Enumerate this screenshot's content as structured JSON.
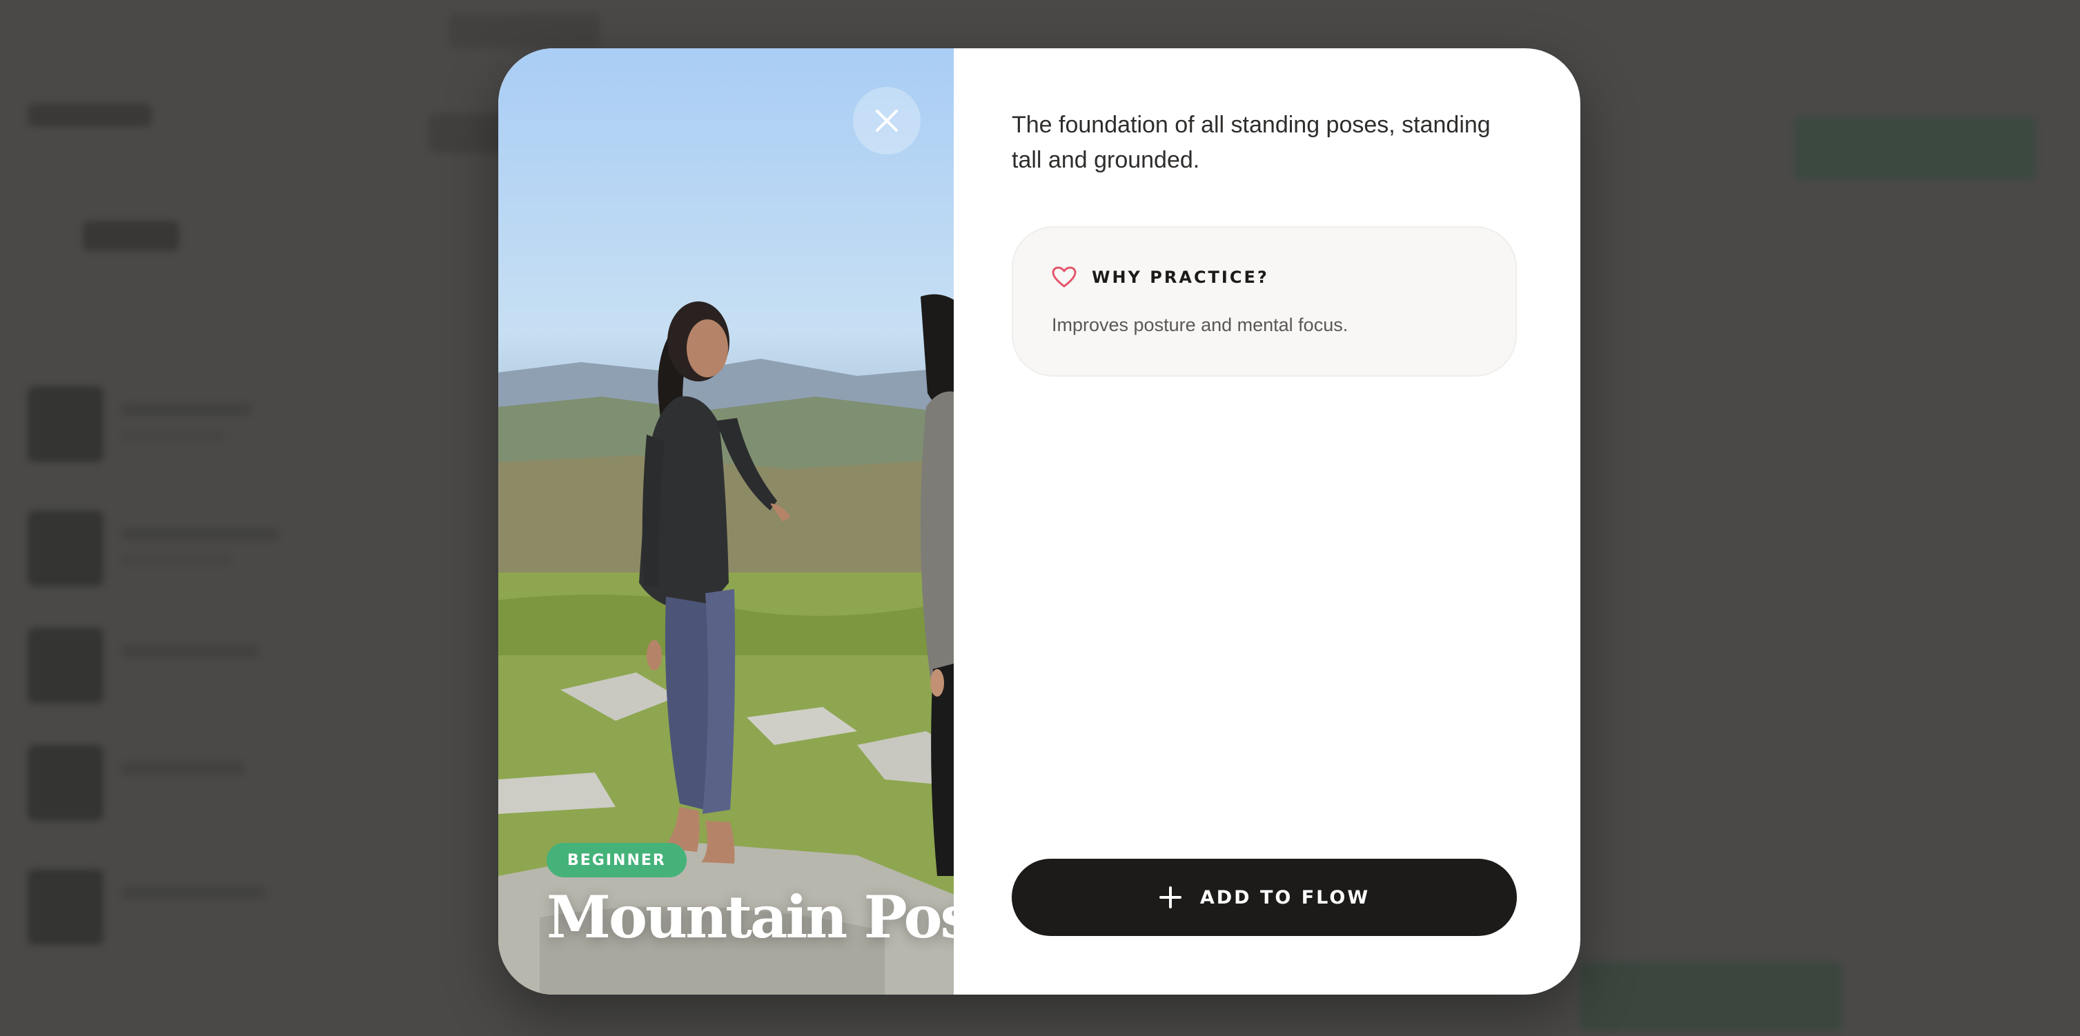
{
  "modal": {
    "description": "The foundation of all standing poses, standing tall and grounded.",
    "benefit": {
      "title": "WHY PRACTICE?",
      "text": "Improves posture and mental focus.",
      "icon": "heart-icon",
      "icon_color": "#e2566b"
    },
    "pose": {
      "name": "Mountain Pose",
      "level": "BEGINNER",
      "level_color": "#45b27a"
    },
    "add_button": {
      "label": "ADD TO FLOW",
      "icon": "plus-icon"
    },
    "close_button": {
      "icon": "close-icon"
    }
  },
  "theme": {
    "overlay": "#4a4948",
    "button_dark": "#1c1b19"
  }
}
